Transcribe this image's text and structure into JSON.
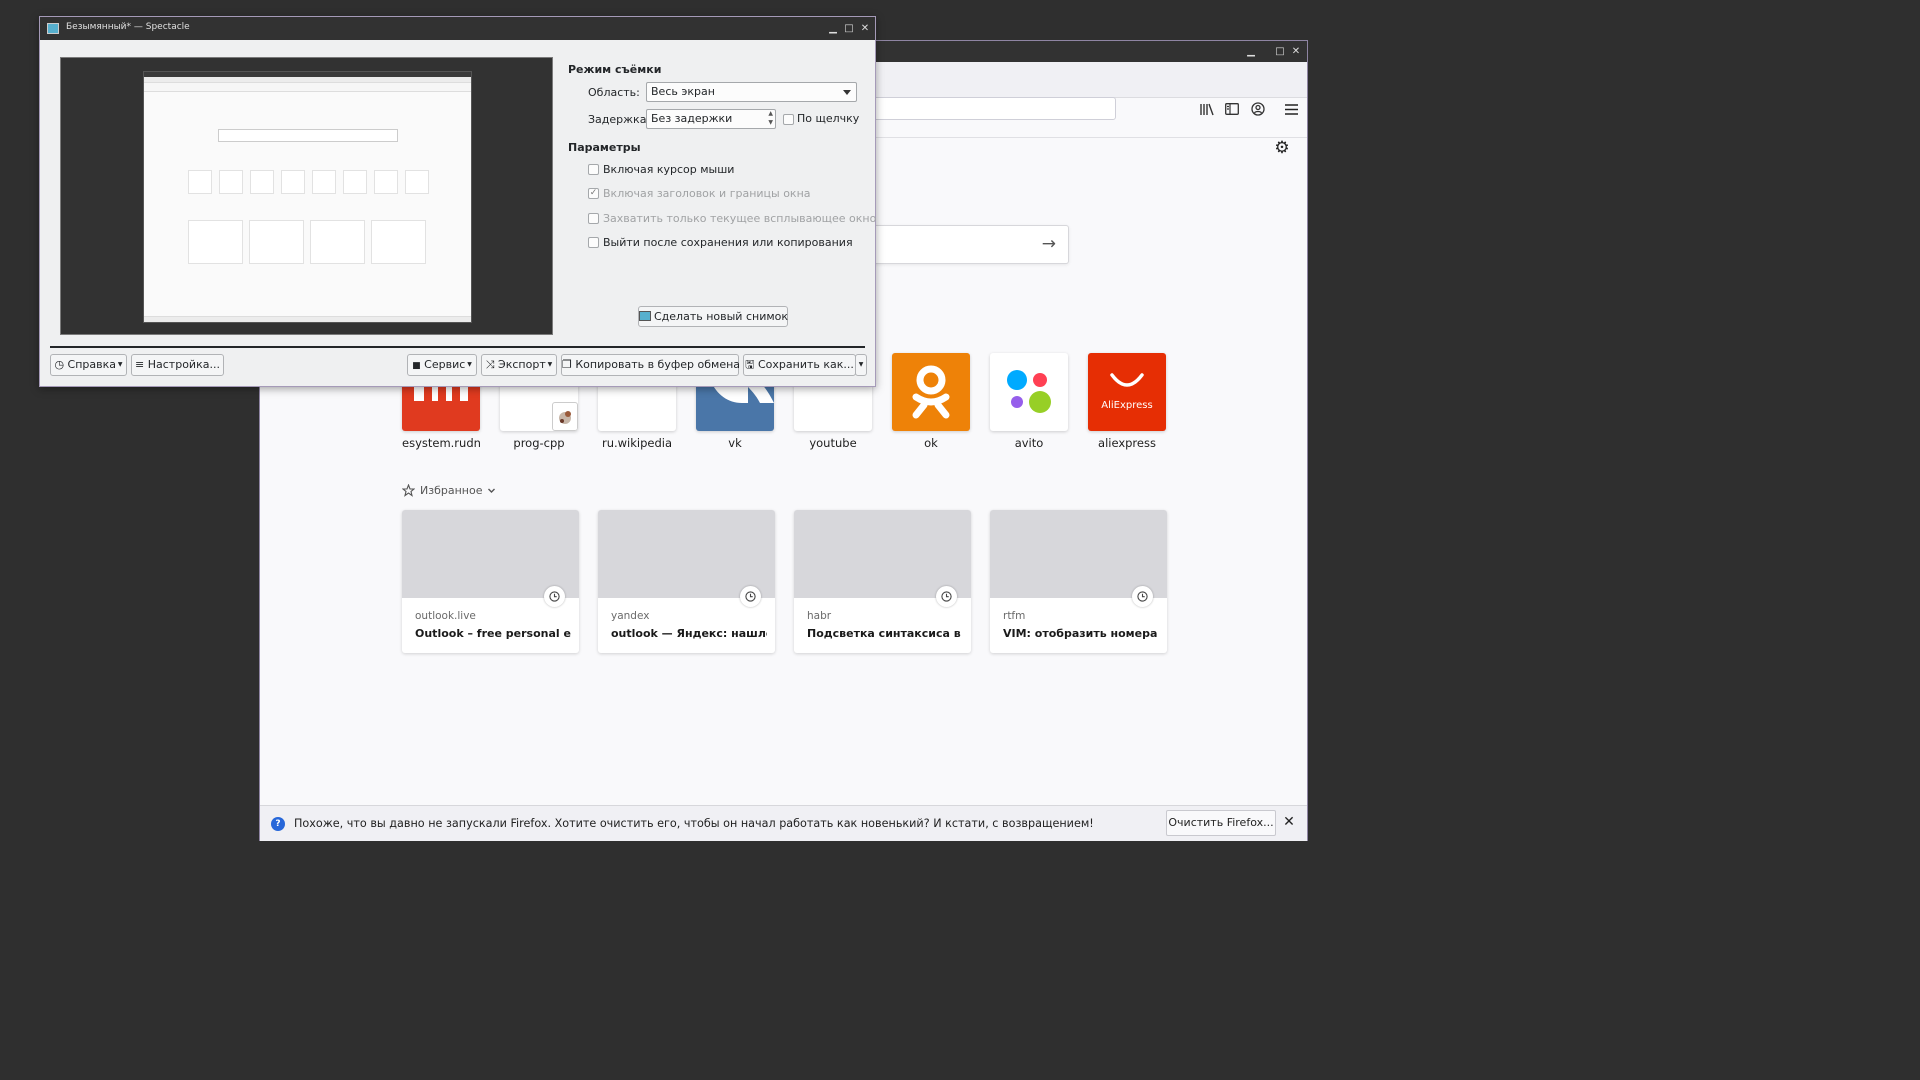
{
  "spectacle": {
    "title": "Безымянный* — Spectacle",
    "capture_mode_heading": "Режим съёмки",
    "area_label": "Область:",
    "area_value": "Весь экран",
    "delay_label": "Задержка:",
    "delay_value": "Без задержки",
    "on_click_label": "По щелчку",
    "options_heading": "Параметры",
    "options": [
      {
        "label": "Включая курсор мыши",
        "checked": false,
        "enabled": true
      },
      {
        "label": "Включая заголовок и границы окна",
        "checked": true,
        "enabled": false
      },
      {
        "label": "Захватить только текущее всплывающее окно",
        "checked": false,
        "enabled": false
      },
      {
        "label": "Выйти после сохранения или копирования",
        "checked": false,
        "enabled": true
      }
    ],
    "new_screenshot_button": "Сделать новый снимок",
    "help_button": "Справка",
    "configure_button": "Настройка...",
    "tools_button": "Сервис",
    "export_button": "Экспорт",
    "copy_button": "Копировать в буфер обмена",
    "save_as_button": "Сохранить как..."
  },
  "firefox": {
    "top_sites": [
      {
        "label": "esystem.rudn",
        "color": "#e03a1f"
      },
      {
        "label": "prog-cpp",
        "color": "#ffffff"
      },
      {
        "label": "ru.wikipedia",
        "color": "#ffffff"
      },
      {
        "label": "vk",
        "color": "#4a76a8"
      },
      {
        "label": "youtube",
        "color": "#ffffff"
      },
      {
        "label": "ok",
        "color": "#ee8208"
      },
      {
        "label": "avito",
        "color": "#ffffff"
      },
      {
        "label": "aliexpress",
        "color": "#e62e04"
      }
    ],
    "aliexpress_logo_text": "AliExpress",
    "highlights_label": "Избранное",
    "highlights": [
      {
        "source": "outlook.live",
        "title": "Outlook – free personal e..."
      },
      {
        "source": "yandex",
        "title": "outlook — Яндекс: нашло..."
      },
      {
        "source": "habr",
        "title": "Подсветка синтаксиса в V..."
      },
      {
        "source": "rtfm",
        "title": "VIM: отобразить номера с..."
      }
    ],
    "notification_text": "Похоже, что вы давно не запускали Firefox. Хотите очистить его, чтобы он начал работать как новенький? И кстати, с возвращением!",
    "refresh_button": "Очистить Firefox...",
    "close_symbol": "✕"
  }
}
